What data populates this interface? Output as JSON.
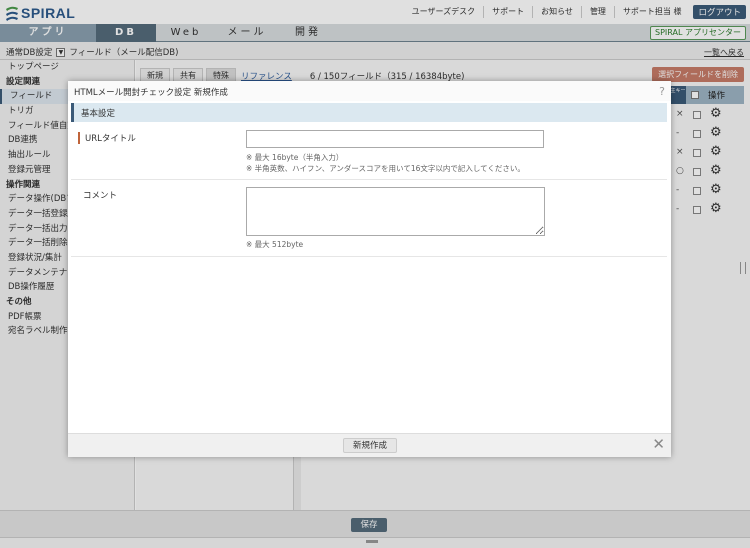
{
  "header": {
    "logo": "SPIRAL",
    "links": [
      "ユーザーズデスク",
      "サポート",
      "お知らせ",
      "管理",
      "サポート担当 様"
    ],
    "logout": "ログアウト"
  },
  "tabs": [
    "アプリ",
    "DB",
    "Web",
    "メール",
    "開発"
  ],
  "active_tab": "DB",
  "app_center": "SPIRAL アプリセンター",
  "breadcrumb": {
    "db": "通常DB設定",
    "current": "フィールド（メール配信DB)"
  },
  "return_link": "一覧へ戻る",
  "sidebar": [
    {
      "label": "トップページ",
      "type": "item"
    },
    {
      "label": "設定関連",
      "type": "header"
    },
    {
      "label": "フィールド",
      "type": "selected"
    },
    {
      "label": "トリガ",
      "type": "item"
    },
    {
      "label": "フィールド値自動",
      "type": "item"
    },
    {
      "label": "DB連携",
      "type": "item"
    },
    {
      "label": "抽出ルール",
      "type": "item"
    },
    {
      "label": "登録元管理",
      "type": "item"
    },
    {
      "label": "操作関連",
      "type": "header"
    },
    {
      "label": "データ操作(DBアプ",
      "type": "item"
    },
    {
      "label": "データ一括登録/",
      "type": "item"
    },
    {
      "label": "データ一括出力",
      "type": "item"
    },
    {
      "label": "データ一括削除",
      "type": "item"
    },
    {
      "label": "登録状況/集計",
      "type": "item"
    },
    {
      "label": "データメンテナン",
      "type": "item"
    },
    {
      "label": "DB操作履歴",
      "type": "item"
    },
    {
      "label": "その他",
      "type": "header"
    },
    {
      "label": "PDF帳票",
      "type": "item"
    },
    {
      "label": "宛名ラベル制作",
      "type": "item"
    }
  ],
  "field_tabs": [
    "新規",
    "共有",
    "特殊"
  ],
  "reference_link": "リファレンス",
  "field_count": "6 / 150フィールド（315 / 16384byte)",
  "delete_selected": "選択フィールドを削除",
  "column_headers": {
    "key": "主キー",
    "ops": "操作"
  },
  "rows": [
    {
      "mark": "×"
    },
    {
      "mark": "-"
    },
    {
      "mark": "×"
    },
    {
      "mark": "○"
    },
    {
      "mark": "-"
    },
    {
      "mark": "-"
    }
  ],
  "save_button": "保存",
  "modal": {
    "title": "HTMLメール開封チェック設定 新規作成",
    "help": "?",
    "section": "基本設定",
    "url_title_label": "URLタイトル",
    "url_title_value": "",
    "url_notes": [
      "※ 最大 16byte（半角入力）",
      "※ 半角英数、ハイフン、アンダースコアを用いて16文字以内で記入してください。"
    ],
    "comment_label": "コメント",
    "comment_value": "",
    "comment_note": "※ 最大 512byte",
    "create_button": "新規作成",
    "close": "✕"
  }
}
